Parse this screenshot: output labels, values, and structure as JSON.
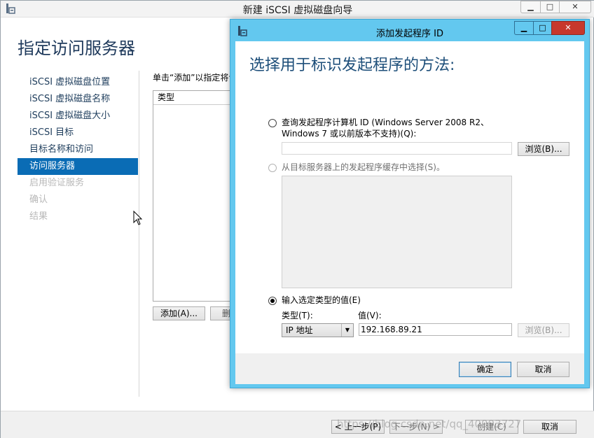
{
  "wizard": {
    "title": "新建 iSCSI 虚拟磁盘向导",
    "heading": "指定访问服务器",
    "window_controls": {
      "minimize": "▁",
      "maximize": "□",
      "close": "✕"
    },
    "nav": [
      {
        "label": "iSCSI 虚拟磁盘位置",
        "state": "normal"
      },
      {
        "label": "iSCSI 虚拟磁盘名称",
        "state": "normal"
      },
      {
        "label": "iSCSI 虚拟磁盘大小",
        "state": "normal"
      },
      {
        "label": "iSCSI 目标",
        "state": "normal"
      },
      {
        "label": "目标名称和访问",
        "state": "normal"
      },
      {
        "label": "访问服务器",
        "state": "active"
      },
      {
        "label": "启用验证服务",
        "state": "disabled"
      },
      {
        "label": "确认",
        "state": "disabled"
      },
      {
        "label": "结果",
        "state": "disabled"
      }
    ],
    "instruction": "单击“添加”以指定将访",
    "list_header": "类型",
    "add_button": "添加(A)...",
    "delete_button": "删除",
    "footer": {
      "prev": "< 上一步(P)",
      "next": "下一步(N) >",
      "create": "创建(C)",
      "cancel": "取消"
    }
  },
  "dialog": {
    "title": "添加发起程序 ID",
    "heading": "选择用于标识发起程序的方法:",
    "window_controls": {
      "minimize": "▁",
      "maximize": "□",
      "close": "✕"
    },
    "option_query": {
      "label": "查询发起程序计算机 ID (Windows Server 2008 R2、Windows 7 或以前版本不支持)(Q):",
      "browse": "浏览(B)..."
    },
    "option_cache": {
      "label": "从目标服务器上的发起程序缓存中选择(S)。"
    },
    "option_manual": {
      "label": "输入选定类型的值(E)",
      "type_label": "类型(T):",
      "value_label": "值(V):",
      "type_value": "IP 地址",
      "value": "192.168.89.21",
      "browse": "浏览(B)..."
    },
    "ok_button": "确定",
    "cancel_button": "取消"
  },
  "watermark": "https://blog.csdn.net/qq_40993727"
}
